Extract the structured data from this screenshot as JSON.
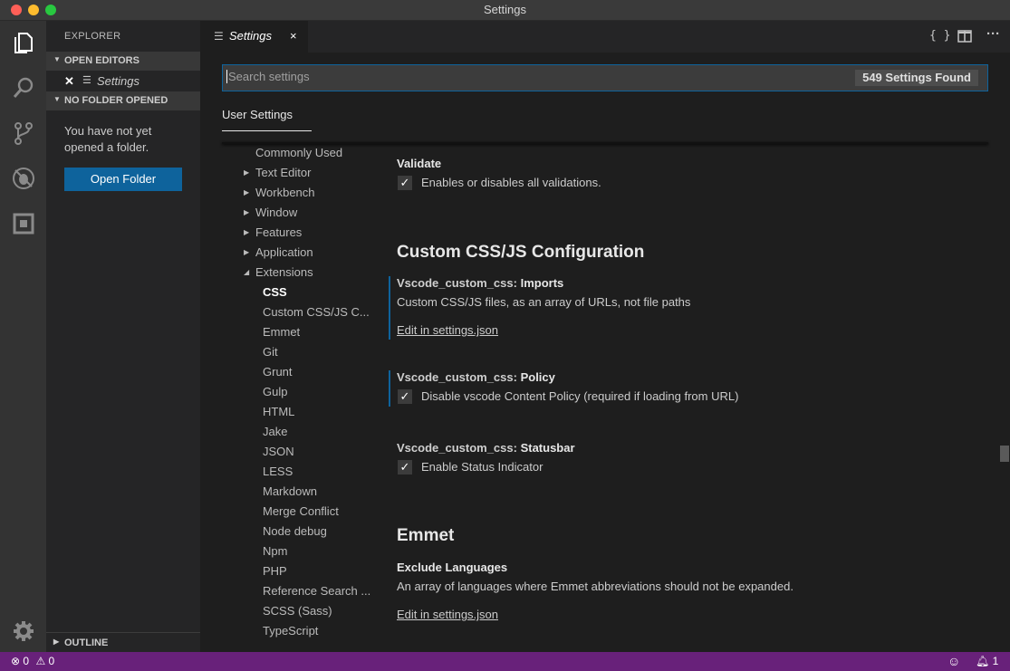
{
  "window": {
    "title": "Settings"
  },
  "sidebar": {
    "title": "EXPLORER",
    "open_editors_label": "OPEN EDITORS",
    "open_editor_item": "Settings",
    "no_folder_label": "NO FOLDER OPENED",
    "message": "You have not yet opened a folder.",
    "open_folder_button": "Open Folder",
    "outline_label": "OUTLINE"
  },
  "tab": {
    "label": "Settings",
    "close": "×"
  },
  "toolbar": {
    "json_icon": "{ }",
    "split_icon": "split-editor-icon",
    "more_icon": "···"
  },
  "search": {
    "placeholder": "Search settings",
    "found": "549 Settings Found"
  },
  "user_settings_tab": "User Settings",
  "toc": {
    "top": [
      "Commonly Used",
      "Text Editor",
      "Workbench",
      "Window",
      "Features",
      "Application",
      "Extensions"
    ],
    "extensions": [
      "CSS",
      "Custom CSS/JS C...",
      "Emmet",
      "Git",
      "Grunt",
      "Gulp",
      "HTML",
      "Jake",
      "JSON",
      "LESS",
      "Markdown",
      "Merge Conflict",
      "Node debug",
      "Npm",
      "PHP",
      "Reference Search ...",
      "SCSS (Sass)",
      "TypeScript"
    ]
  },
  "settings": {
    "validate": {
      "title": "Validate",
      "desc": "Enables or disables all validations."
    },
    "group_custom": "Custom CSS/JS Configuration",
    "imports": {
      "prefix": "Vscode_custom_css: ",
      "name": "Imports",
      "desc": "Custom CSS/JS files, as an array of URLs, not file paths",
      "link": "Edit in settings.json"
    },
    "policy": {
      "prefix": "Vscode_custom_css: ",
      "name": "Policy",
      "desc": "Disable vscode Content Policy (required if loading from URL)"
    },
    "statusbar": {
      "prefix": "Vscode_custom_css: ",
      "name": "Statusbar",
      "desc": "Enable Status Indicator"
    },
    "group_emmet": "Emmet",
    "exclude": {
      "title": "Exclude Languages",
      "desc": "An array of languages where Emmet abbreviations should not be expanded.",
      "link": "Edit in settings.json"
    }
  },
  "status": {
    "errors": "0",
    "warnings": "0",
    "notifications": "1"
  },
  "colors": {
    "accent": "#0e639c",
    "statusbar": "#68217a"
  }
}
